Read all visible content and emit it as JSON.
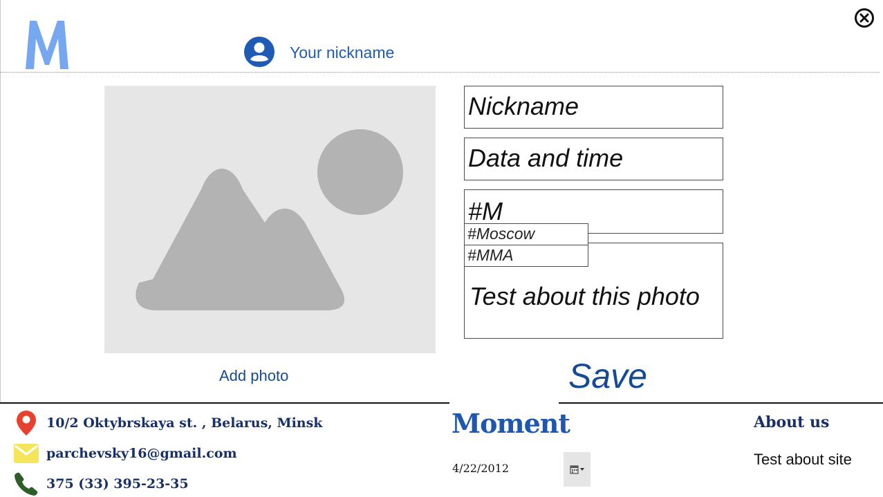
{
  "header": {
    "logo_letter": "M",
    "logo_color": "#76a7f0",
    "profile_link": "Your nickname",
    "close_icon": "close-circle-icon"
  },
  "photo_panel": {
    "placeholder_icon": "image-placeholder-icon",
    "add_photo_label": "Add photo"
  },
  "form": {
    "nickname_placeholder": "Nickname",
    "datetime_placeholder": "Data and time",
    "tags_value": "#M",
    "tag_suggestions": [
      "#Moscow",
      "#MMA"
    ],
    "description_placeholder": "Test about this photo",
    "save_label": "Save"
  },
  "footer": {
    "address": "10/2 Oktybrskaya st. , Belarus, Minsk",
    "email": "parchevsky16@gmail.com",
    "phone": "375 (33) 395-23-35",
    "brand": "Moment",
    "date_value": "4/22/2012",
    "about_title": "About us",
    "about_text": "Test about site"
  },
  "colors": {
    "accent": "#174a94",
    "link": "#1f5bb5",
    "location_pin": "#e8402e",
    "mail": "#f5e55b",
    "phone": "#2f5d2a"
  }
}
